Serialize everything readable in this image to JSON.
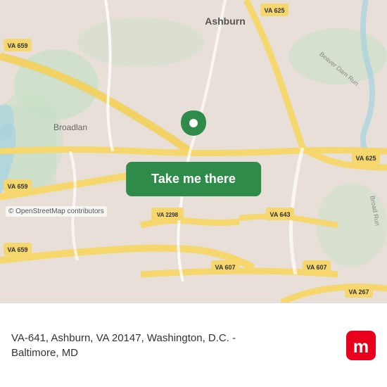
{
  "map": {
    "alt": "Map of Ashburn, VA area",
    "copyright": "© OpenStreetMap contributors"
  },
  "button": {
    "label": "Take me there"
  },
  "address": {
    "line1": "VA-641, Ashburn, VA 20147, Washington, D.C. -",
    "line2": "Baltimore, MD"
  },
  "logo": {
    "alt": "moovit"
  },
  "colors": {
    "button_bg": "#2e8b4a",
    "map_bg": "#e8e0d8",
    "road_yellow": "#f5d76e",
    "road_white": "#ffffff",
    "water": "#aad3df",
    "green_area": "#c8dfc8"
  }
}
